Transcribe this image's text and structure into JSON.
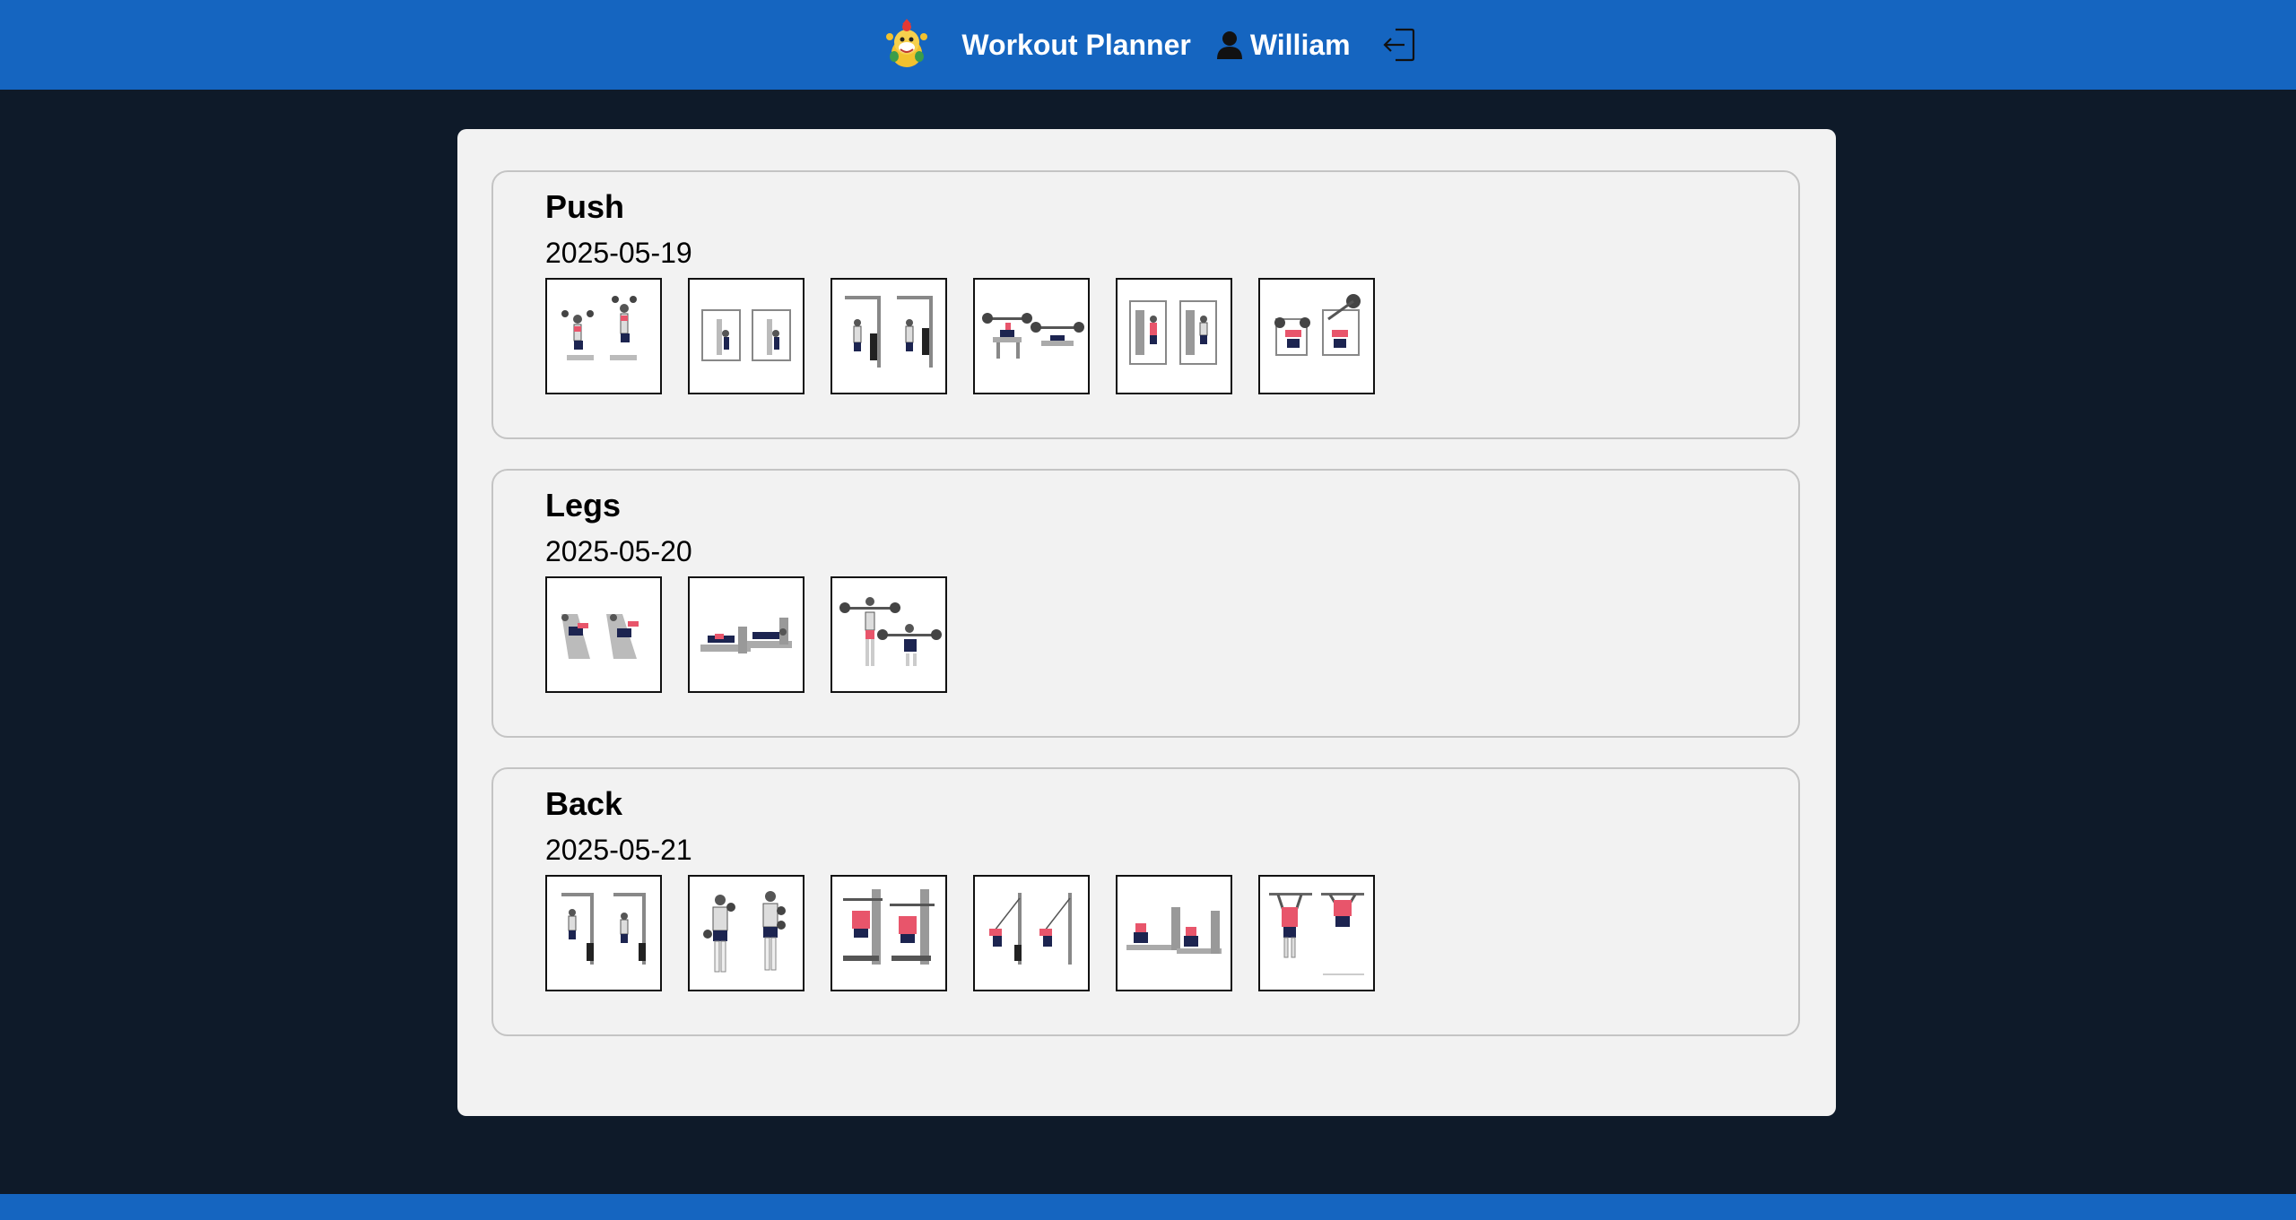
{
  "header": {
    "app_title": "Workout Planner",
    "user_name": "William",
    "logo_icon": "bowser-jr-mascot-icon",
    "user_icon": "person-icon",
    "logout_icon": "logout-icon"
  },
  "colors": {
    "header_bg": "#1565c0",
    "page_bg": "#0e1a29",
    "panel_bg": "#f2f2f2",
    "accent_red": "#e8556b",
    "figure_navy": "#1c2450"
  },
  "workouts": [
    {
      "name": "Push",
      "date": "2025-05-19",
      "exercises": [
        "seated-dumbbell-press-icon",
        "machine-chest-fly-icon",
        "cable-pushdown-icon",
        "barbell-bench-press-icon",
        "machine-shoulder-press-icon",
        "incline-dumbbell-press-icon"
      ]
    },
    {
      "name": "Legs",
      "date": "2025-05-20",
      "exercises": [
        "leg-extension-icon",
        "lying-leg-curl-icon",
        "barbell-squat-icon"
      ]
    },
    {
      "name": "Back",
      "date": "2025-05-21",
      "exercises": [
        "cable-row-standing-icon",
        "dumbbell-shrug-icon",
        "lat-pulldown-icon",
        "cable-pullover-icon",
        "seated-cable-row-icon",
        "pull-up-icon"
      ]
    }
  ]
}
